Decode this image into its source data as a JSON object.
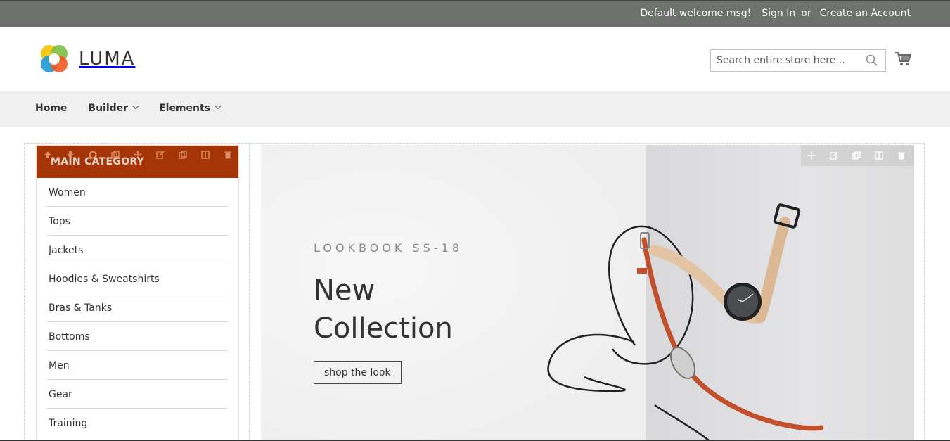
{
  "topbar": {
    "welcome": "Default welcome msg!",
    "sign_in": "Sign In",
    "or": "or",
    "create_account": "Create an Account"
  },
  "header": {
    "brand": "LUMA",
    "search_placeholder": "Search entire store here...",
    "icons": [
      "search-icon",
      "cart-icon"
    ]
  },
  "nav": {
    "items": [
      {
        "label": "Home",
        "has_dropdown": false
      },
      {
        "label": "Builder",
        "has_dropdown": true
      },
      {
        "label": "Elements",
        "has_dropdown": true
      }
    ]
  },
  "sidebar": {
    "title": "MAIN CATEGORY",
    "accent_color": "#a53506",
    "categories": [
      "Women",
      "Tops",
      "Jackets",
      "Hoodies & Sweatshirts",
      "Bras & Tanks",
      "Bottoms",
      "Men",
      "Gear",
      "Training"
    ]
  },
  "banner": {
    "kicker": "LOOKBOOK SS-18",
    "headline_line1": "New",
    "headline_line2": "Collection",
    "cta_label": "shop the look"
  },
  "builder_tools": [
    "move-icon",
    "edit-icon",
    "duplicate-icon",
    "columns-icon",
    "delete-icon"
  ]
}
